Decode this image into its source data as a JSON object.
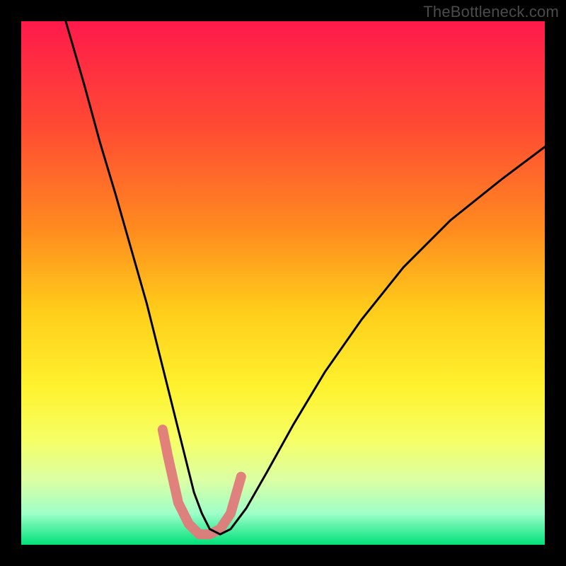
{
  "watermark": {
    "text": "TheBottleneck.com"
  },
  "chart_data": {
    "type": "line",
    "title": "",
    "xlabel": "",
    "ylabel": "",
    "xlim": [
      0,
      100
    ],
    "ylim": [
      0,
      100
    ],
    "grid": false,
    "legend": false,
    "background_gradient_stops": [
      {
        "offset": 0.0,
        "color": "#ff1a4b"
      },
      {
        "offset": 0.2,
        "color": "#ff4a33"
      },
      {
        "offset": 0.4,
        "color": "#ff8c1f"
      },
      {
        "offset": 0.55,
        "color": "#ffcc1a"
      },
      {
        "offset": 0.7,
        "color": "#fff22e"
      },
      {
        "offset": 0.8,
        "color": "#f6ff66"
      },
      {
        "offset": 0.88,
        "color": "#d9ffa6"
      },
      {
        "offset": 0.94,
        "color": "#9effc8"
      },
      {
        "offset": 1.0,
        "color": "#00e07a"
      }
    ],
    "series": [
      {
        "name": "bottleneck-curve",
        "color": "#000000",
        "x": [
          8.5,
          12,
          15,
          18,
          20,
          22,
          24,
          25.5,
          27,
          28.5,
          30,
          31.5,
          33,
          34.5,
          36,
          38,
          40,
          43,
          47,
          52,
          58,
          65,
          73,
          82,
          92,
          100
        ],
        "y": [
          100,
          88,
          77,
          67,
          60,
          53,
          46,
          40,
          34,
          28,
          22,
          16,
          10,
          6,
          3,
          2,
          3,
          7,
          14,
          23,
          33,
          43,
          53,
          62,
          70,
          76
        ]
      },
      {
        "name": "highlight-band",
        "color": "#e07a7a",
        "x": [
          27,
          28,
          30,
          32,
          34,
          36,
          38,
          40,
          42
        ],
        "y": [
          22,
          17,
          8,
          4,
          2,
          2,
          3,
          6,
          13
        ]
      }
    ]
  }
}
